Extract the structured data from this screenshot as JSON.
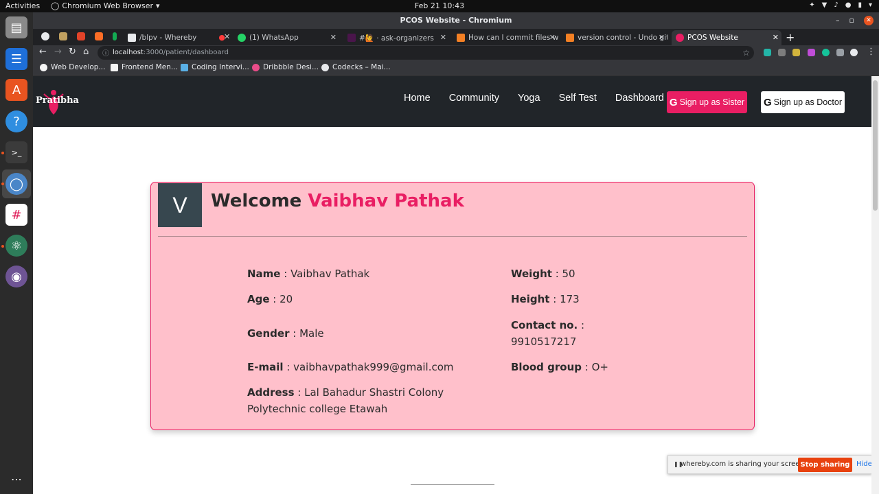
{
  "system": {
    "activities": "Activities",
    "app_name": "Chromium Web Browser",
    "clock": "Feb 21  10:43"
  },
  "window": {
    "title": "PCOS Website - Chromium"
  },
  "tabs": [
    {
      "label": "/blpv - Whereby"
    },
    {
      "label": "(1) WhatsApp"
    },
    {
      "label": "#🙋 · ask-organizers"
    },
    {
      "label": "How can I commit files wi"
    },
    {
      "label": "version control - Undo git"
    },
    {
      "label": "PCOS Website"
    }
  ],
  "address_bar": {
    "host": "localhost",
    "path": ":3000/patient/dashboard"
  },
  "bookmarks": [
    {
      "label": "Web Develop..."
    },
    {
      "label": "Frontend Men..."
    },
    {
      "label": "Coding Intervi..."
    },
    {
      "label": "Dribbble Desi..."
    },
    {
      "label": "Codecks – Mai..."
    }
  ],
  "site": {
    "brand": "Pratibha",
    "nav": [
      {
        "label": "Home"
      },
      {
        "label": "Community"
      },
      {
        "label": "Yoga"
      },
      {
        "label": "Self Test"
      },
      {
        "label": "Dashboard"
      }
    ],
    "sister_button": "Sign up as Sister",
    "doctor_button": "Sign up as Doctor",
    "google_glyph": "G"
  },
  "profile": {
    "avatar_letter": "V",
    "welcome": "Welcome",
    "user_name": "Vaibhav Pathak",
    "fields": {
      "name_label": "Name",
      "name_value": "Vaibhav Pathak",
      "age_label": "Age",
      "age_value": "20",
      "gender_label": "Gender",
      "gender_value": "Male",
      "email_label": "E-mail",
      "email_value": "vaibhavpathak999@gmail.com",
      "address_label": "Address",
      "address_value": "Lal Bahadur Shastri Colony Polytechnic college Etawah",
      "weight_label": "Weight",
      "weight_value": "50",
      "height_label": "Height",
      "height_value": "173",
      "contact_label": "Contact no.",
      "contact_value": "9910517217",
      "blood_label": "Blood group",
      "blood_value": "O+"
    }
  },
  "share_bar": {
    "message": "whereby.com is sharing your screen.",
    "stop": "Stop sharing",
    "hide": "Hide"
  },
  "colors": {
    "accent": "#e91e63",
    "card_bg": "#ffc0cb",
    "nav_bg": "#212529",
    "avatar_bg": "#37474f"
  }
}
